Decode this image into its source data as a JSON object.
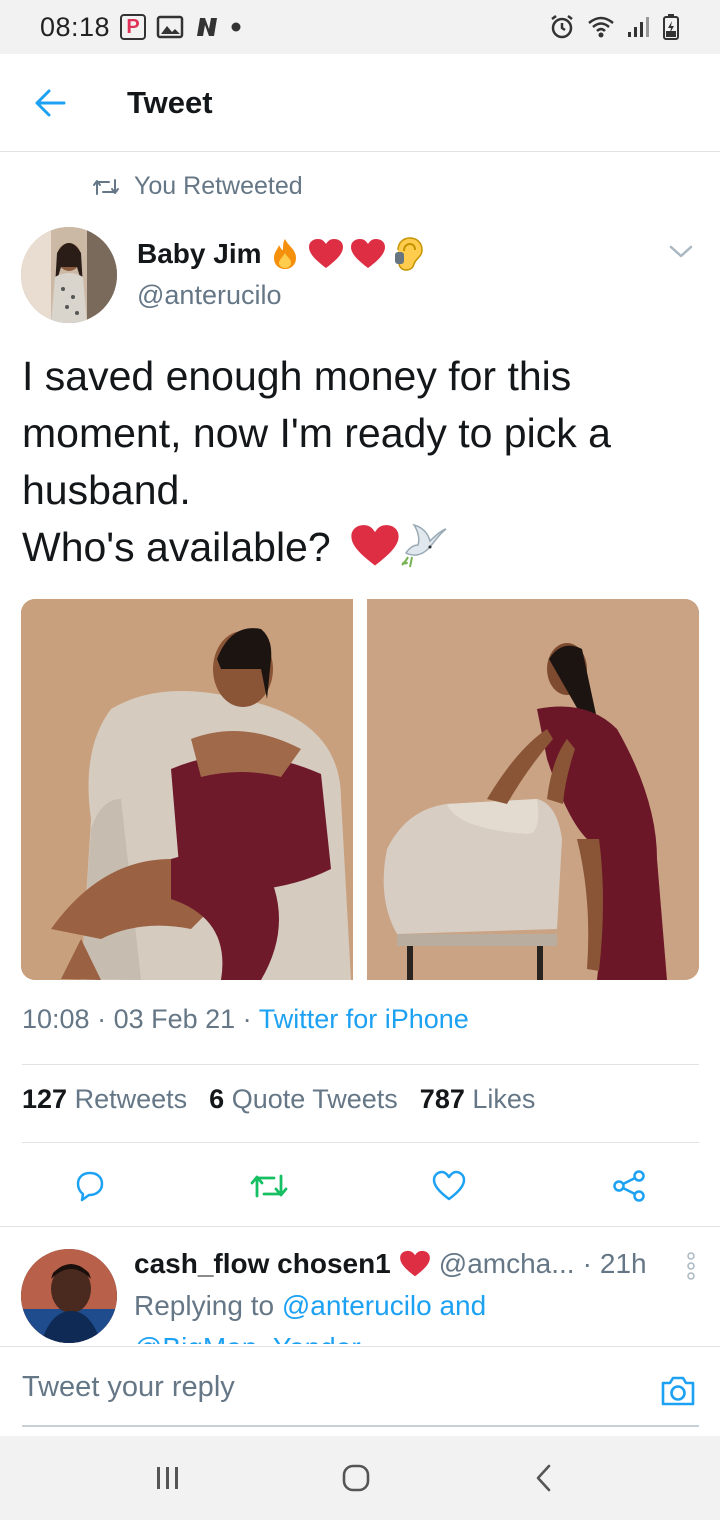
{
  "status_bar": {
    "time": "08:18",
    "left_icons": [
      "paypal-icon",
      "gallery-icon",
      "n-icon",
      "dot-icon"
    ],
    "right_icons": [
      "alarm-icon",
      "wifi-icon",
      "signal-icon",
      "battery-icon"
    ]
  },
  "header": {
    "title": "Tweet"
  },
  "retweet_context": {
    "label": "You Retweeted"
  },
  "tweet": {
    "author_name": "Baby Jim",
    "author_emojis": [
      "fire",
      "heart",
      "heart",
      "ear"
    ],
    "author_handle": "@anterucilo",
    "text_lines": [
      "I saved enough money for this",
      "moment, now I'm ready to pick a",
      "husband.",
      "Who's available?"
    ],
    "text_trailing_emojis": [
      "heart",
      "dove"
    ],
    "photos": [
      {
        "description_icon": "photo-woman-seated-chair-icon"
      },
      {
        "description_icon": "photo-woman-leaning-chair-icon"
      }
    ],
    "time": "10:08",
    "date": "03 Feb 21",
    "source": "Twitter for iPhone",
    "retweets_count": "127",
    "retweets_label": "Retweets",
    "quote_count": "6",
    "quote_label": "Quote Tweets",
    "likes_count": "787",
    "likes_label": "Likes"
  },
  "reply": {
    "name": "cash_flow chosen1",
    "handle": "@amcha...",
    "age": "21h",
    "replying_prefix": "Replying to",
    "replying_to": "@anterucilo and",
    "replying_to_more": "@BigMan_Yonder"
  },
  "compose": {
    "placeholder": "Tweet your reply"
  },
  "colors": {
    "accent": "#1da1f2",
    "retweet_green": "#17bf63",
    "heart_red": "#e0245e",
    "text_secondary": "#657786"
  }
}
